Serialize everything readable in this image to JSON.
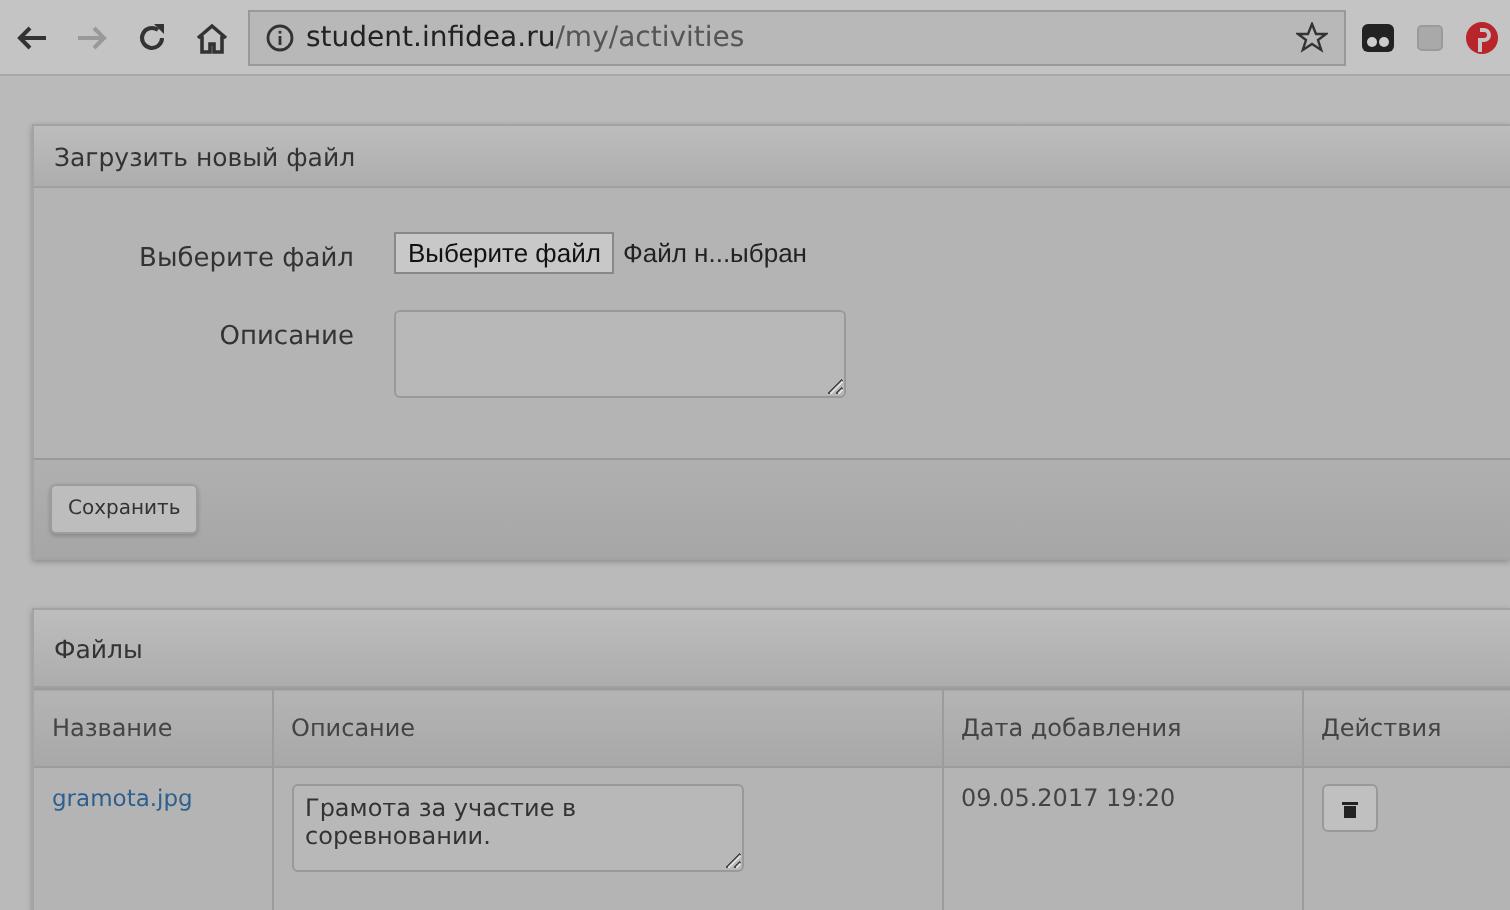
{
  "browser": {
    "url_host": "student.infidea.ru",
    "url_path": "/my/activities"
  },
  "upload_panel": {
    "title": "Загрузить новый файл",
    "file_label": "Выберите файл",
    "file_button": "Выберите файл",
    "file_status": "Файл н...ыбран",
    "description_label": "Описание",
    "save_button": "Сохранить"
  },
  "files_panel": {
    "title": "Файлы",
    "columns": [
      "Название",
      "Описание",
      "Дата добавления",
      "Действия"
    ],
    "rows": [
      {
        "name": "gramota.jpg",
        "description": "Грамота за участие в соревновании.",
        "date": "09.05.2017 19:20"
      }
    ]
  }
}
